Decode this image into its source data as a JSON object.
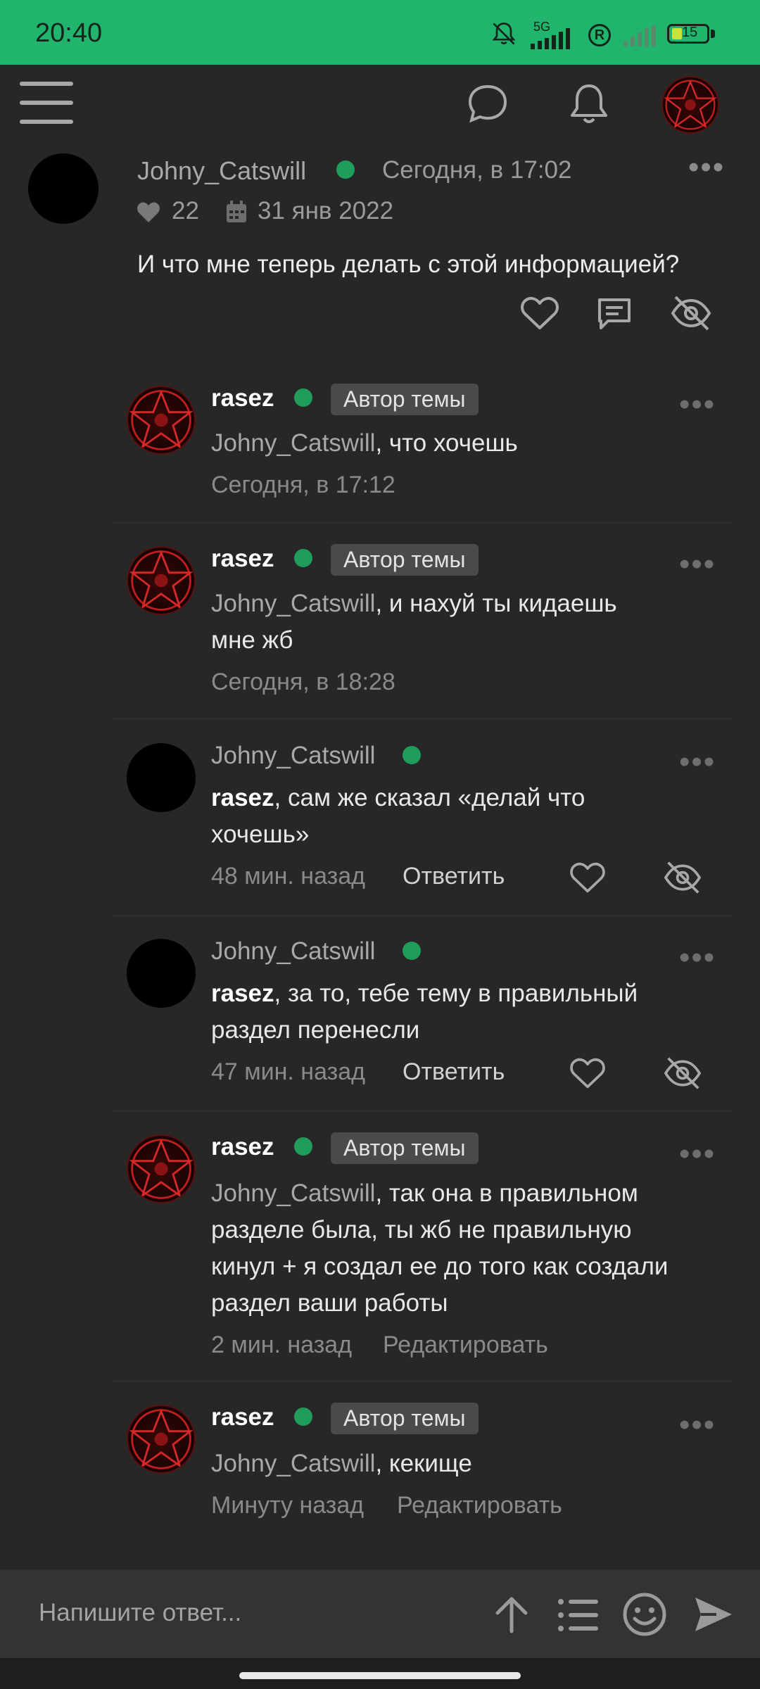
{
  "status_bar": {
    "time": "20:40",
    "network": "5G",
    "battery": "15"
  },
  "post": {
    "author": "Johny_Catswill",
    "time": "Сегодня, в 17:02",
    "likes": "22",
    "registered": "31 янв 2022",
    "text": "И что мне теперь делать с этой информацией?"
  },
  "comments": [
    {
      "author": "rasez",
      "badge": "Автор темы",
      "mention": "Johny_Catswill",
      "text": ", что хочешь",
      "time": "Сегодня, в 17:12"
    },
    {
      "author": "rasez",
      "badge": "Автор темы",
      "mention": "Johny_Catswill",
      "text": ", и нахуй ты кидаешь",
      "text2": "мне жб",
      "time": "Сегодня, в 18:28"
    },
    {
      "author": "Johny_Catswill",
      "mention": "rasez",
      "text": ", сам же сказал «делай что",
      "text2": "хочешь»",
      "time": "48 мин. назад",
      "action": "Ответить"
    },
    {
      "author": "Johny_Catswill",
      "mention": "rasez",
      "text": ", за то, тебе тему в правильный",
      "text2": "раздел перенесли",
      "time": "47 мин. назад",
      "action": "Ответить"
    },
    {
      "author": "rasez",
      "badge": "Автор темы",
      "mention": "Johny_Catswill",
      "text": ", так она в правильном",
      "text2": "разделе была, ты жб не правильную",
      "text3": "кинул + я создал ее до того как создали",
      "text4": "раздел ваши работы",
      "time": "2 мин. назад",
      "action": "Редактировать"
    },
    {
      "author": "rasez",
      "badge": "Автор темы",
      "mention": "Johny_Catswill",
      "text": ", кекище",
      "time": "Минуту назад",
      "action": "Редактировать"
    }
  ],
  "reply": {
    "placeholder": "Напишите ответ..."
  },
  "icons": {
    "menu": "hamburger-menu-icon",
    "chat": "chat-bubble-icon",
    "bell": "bell-icon",
    "like": "heart-icon",
    "comment": "comment-icon",
    "hide": "eye-off-icon",
    "up": "arrow-up-icon",
    "list": "list-icon",
    "emoji": "smiley-icon",
    "send": "send-icon"
  },
  "colors": {
    "status_bar": "#21b46c",
    "background": "#272727",
    "online": "#1f9d5a"
  }
}
